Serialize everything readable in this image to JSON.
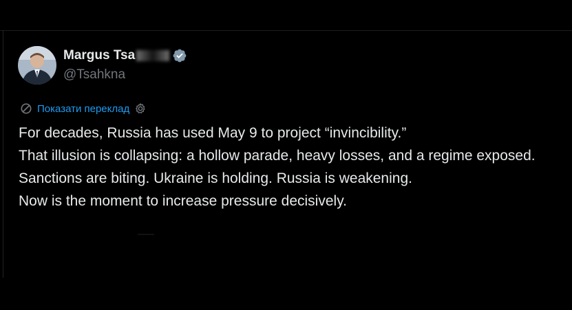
{
  "author": {
    "display_name": "Margus Tsa",
    "handle": "@Tsahkna",
    "verified_icon": "verified-badge-icon",
    "avatar_icon": "avatar-photo"
  },
  "translate": {
    "label": "Показати переклад",
    "icon": "translate-icon",
    "settings_icon": "gear-icon"
  },
  "tweet": {
    "lines": [
      "For decades, Russia has used May 9 to project “invincibility.”",
      "That illusion is collapsing: a hollow parade, heavy losses, and a regime exposed.",
      "Sanctions are biting. Ukraine is holding. Russia is weakening.",
      "Now is the moment to increase pressure decisively."
    ]
  },
  "colors": {
    "background": "#000000",
    "text": "#e7e9ea",
    "muted": "#71767b",
    "accent": "#1d9bf0"
  }
}
